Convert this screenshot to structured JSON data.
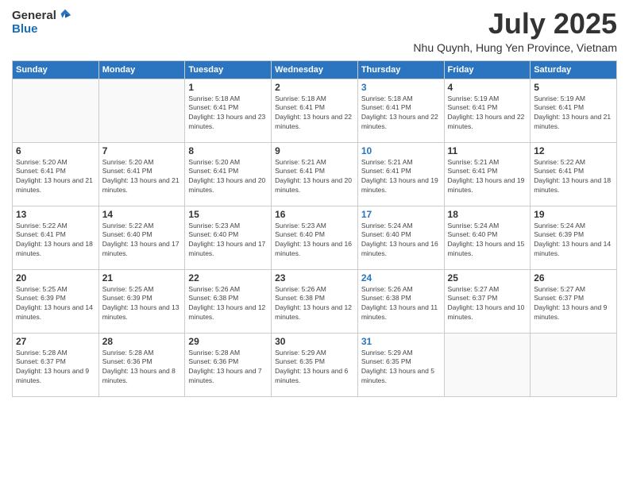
{
  "logo": {
    "general": "General",
    "blue": "Blue"
  },
  "title": {
    "month": "July 2025",
    "location": "Nhu Quynh, Hung Yen Province, Vietnam"
  },
  "weekdays": [
    "Sunday",
    "Monday",
    "Tuesday",
    "Wednesday",
    "Thursday",
    "Friday",
    "Saturday"
  ],
  "weeks": [
    [
      {
        "day": "",
        "info": ""
      },
      {
        "day": "",
        "info": ""
      },
      {
        "day": "1",
        "info": "Sunrise: 5:18 AM\nSunset: 6:41 PM\nDaylight: 13 hours and 23 minutes."
      },
      {
        "day": "2",
        "info": "Sunrise: 5:18 AM\nSunset: 6:41 PM\nDaylight: 13 hours and 22 minutes."
      },
      {
        "day": "3",
        "info": "Sunrise: 5:18 AM\nSunset: 6:41 PM\nDaylight: 13 hours and 22 minutes.",
        "thu": true
      },
      {
        "day": "4",
        "info": "Sunrise: 5:19 AM\nSunset: 6:41 PM\nDaylight: 13 hours and 22 minutes."
      },
      {
        "day": "5",
        "info": "Sunrise: 5:19 AM\nSunset: 6:41 PM\nDaylight: 13 hours and 21 minutes."
      }
    ],
    [
      {
        "day": "6",
        "info": "Sunrise: 5:20 AM\nSunset: 6:41 PM\nDaylight: 13 hours and 21 minutes."
      },
      {
        "day": "7",
        "info": "Sunrise: 5:20 AM\nSunset: 6:41 PM\nDaylight: 13 hours and 21 minutes."
      },
      {
        "day": "8",
        "info": "Sunrise: 5:20 AM\nSunset: 6:41 PM\nDaylight: 13 hours and 20 minutes."
      },
      {
        "day": "9",
        "info": "Sunrise: 5:21 AM\nSunset: 6:41 PM\nDaylight: 13 hours and 20 minutes."
      },
      {
        "day": "10",
        "info": "Sunrise: 5:21 AM\nSunset: 6:41 PM\nDaylight: 13 hours and 19 minutes.",
        "thu": true
      },
      {
        "day": "11",
        "info": "Sunrise: 5:21 AM\nSunset: 6:41 PM\nDaylight: 13 hours and 19 minutes."
      },
      {
        "day": "12",
        "info": "Sunrise: 5:22 AM\nSunset: 6:41 PM\nDaylight: 13 hours and 18 minutes."
      }
    ],
    [
      {
        "day": "13",
        "info": "Sunrise: 5:22 AM\nSunset: 6:41 PM\nDaylight: 13 hours and 18 minutes."
      },
      {
        "day": "14",
        "info": "Sunrise: 5:22 AM\nSunset: 6:40 PM\nDaylight: 13 hours and 17 minutes."
      },
      {
        "day": "15",
        "info": "Sunrise: 5:23 AM\nSunset: 6:40 PM\nDaylight: 13 hours and 17 minutes."
      },
      {
        "day": "16",
        "info": "Sunrise: 5:23 AM\nSunset: 6:40 PM\nDaylight: 13 hours and 16 minutes."
      },
      {
        "day": "17",
        "info": "Sunrise: 5:24 AM\nSunset: 6:40 PM\nDaylight: 13 hours and 16 minutes.",
        "thu": true
      },
      {
        "day": "18",
        "info": "Sunrise: 5:24 AM\nSunset: 6:40 PM\nDaylight: 13 hours and 15 minutes."
      },
      {
        "day": "19",
        "info": "Sunrise: 5:24 AM\nSunset: 6:39 PM\nDaylight: 13 hours and 14 minutes."
      }
    ],
    [
      {
        "day": "20",
        "info": "Sunrise: 5:25 AM\nSunset: 6:39 PM\nDaylight: 13 hours and 14 minutes."
      },
      {
        "day": "21",
        "info": "Sunrise: 5:25 AM\nSunset: 6:39 PM\nDaylight: 13 hours and 13 minutes."
      },
      {
        "day": "22",
        "info": "Sunrise: 5:26 AM\nSunset: 6:38 PM\nDaylight: 13 hours and 12 minutes."
      },
      {
        "day": "23",
        "info": "Sunrise: 5:26 AM\nSunset: 6:38 PM\nDaylight: 13 hours and 12 minutes."
      },
      {
        "day": "24",
        "info": "Sunrise: 5:26 AM\nSunset: 6:38 PM\nDaylight: 13 hours and 11 minutes.",
        "thu": true
      },
      {
        "day": "25",
        "info": "Sunrise: 5:27 AM\nSunset: 6:37 PM\nDaylight: 13 hours and 10 minutes."
      },
      {
        "day": "26",
        "info": "Sunrise: 5:27 AM\nSunset: 6:37 PM\nDaylight: 13 hours and 9 minutes."
      }
    ],
    [
      {
        "day": "27",
        "info": "Sunrise: 5:28 AM\nSunset: 6:37 PM\nDaylight: 13 hours and 9 minutes."
      },
      {
        "day": "28",
        "info": "Sunrise: 5:28 AM\nSunset: 6:36 PM\nDaylight: 13 hours and 8 minutes."
      },
      {
        "day": "29",
        "info": "Sunrise: 5:28 AM\nSunset: 6:36 PM\nDaylight: 13 hours and 7 minutes."
      },
      {
        "day": "30",
        "info": "Sunrise: 5:29 AM\nSunset: 6:35 PM\nDaylight: 13 hours and 6 minutes."
      },
      {
        "day": "31",
        "info": "Sunrise: 5:29 AM\nSunset: 6:35 PM\nDaylight: 13 hours and 5 minutes.",
        "thu": true
      },
      {
        "day": "",
        "info": ""
      },
      {
        "day": "",
        "info": ""
      }
    ]
  ]
}
